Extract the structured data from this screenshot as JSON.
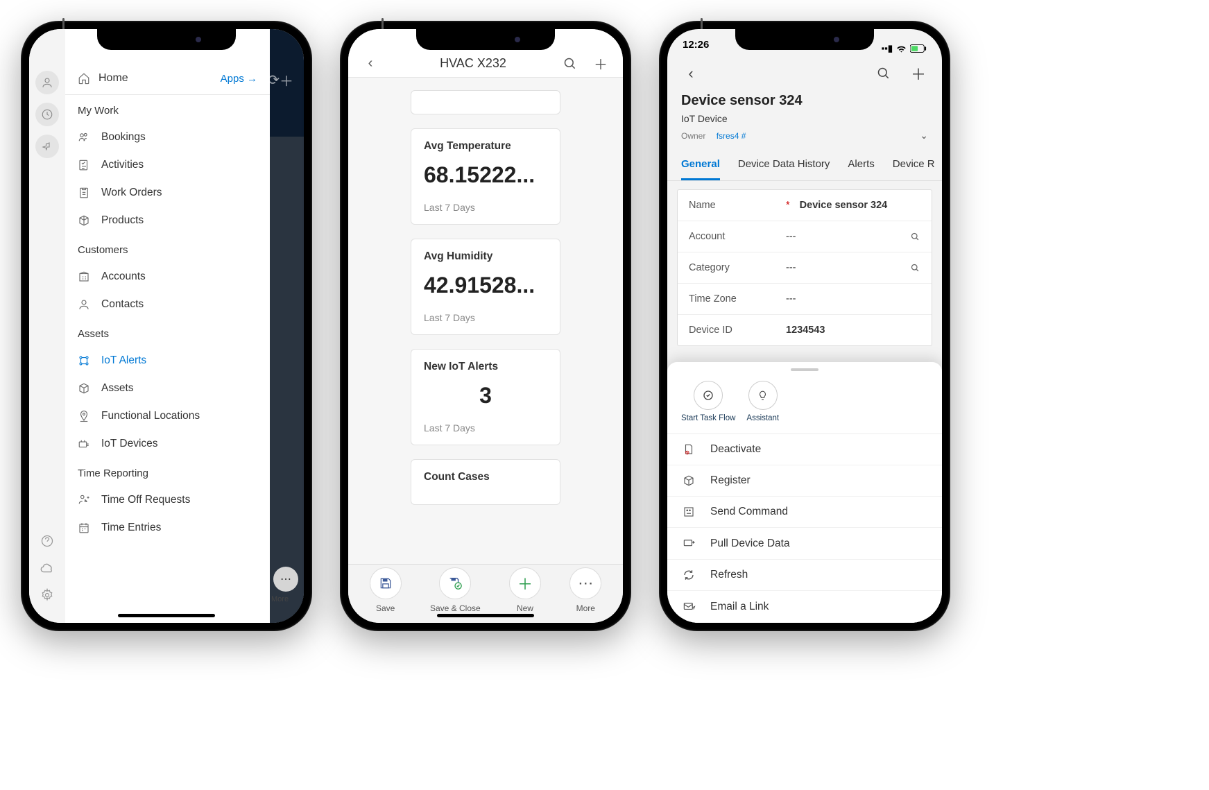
{
  "phone1": {
    "home": "Home",
    "apps": "Apps →",
    "sections": {
      "mywork": {
        "title": "My Work",
        "items": [
          {
            "icon": "bookings",
            "label": "Bookings"
          },
          {
            "icon": "activities",
            "label": "Activities"
          },
          {
            "icon": "workorders",
            "label": "Work Orders"
          },
          {
            "icon": "products",
            "label": "Products"
          }
        ]
      },
      "customers": {
        "title": "Customers",
        "items": [
          {
            "icon": "accounts",
            "label": "Accounts"
          },
          {
            "icon": "contacts",
            "label": "Contacts"
          }
        ]
      },
      "assets": {
        "title": "Assets",
        "items": [
          {
            "icon": "iotalerts",
            "label": "IoT Alerts",
            "active": true
          },
          {
            "icon": "assets",
            "label": "Assets"
          },
          {
            "icon": "locations",
            "label": "Functional Locations"
          },
          {
            "icon": "iotdevices",
            "label": "IoT Devices"
          }
        ]
      },
      "time": {
        "title": "Time Reporting",
        "items": [
          {
            "icon": "timeoff",
            "label": "Time Off Requests"
          },
          {
            "icon": "timeentries",
            "label": "Time Entries"
          }
        ]
      }
    },
    "more": "More"
  },
  "phone2": {
    "title": "HVAC X232",
    "cards": [
      {
        "title": "Avg Temperature",
        "value": "68.15222...",
        "sub": "Last 7 Days"
      },
      {
        "title": "Avg Humidity",
        "value": "42.91528...",
        "sub": "Last 7 Days"
      },
      {
        "title": "New IoT Alerts",
        "value": "3",
        "sub": "Last 7 Days",
        "center": true
      },
      {
        "title": "Count Cases",
        "value": "",
        "sub": ""
      }
    ],
    "bottom": [
      {
        "icon": "💾",
        "label": "Save",
        "color": "#3b5998"
      },
      {
        "icon": "save-close",
        "label": "Save & Close"
      },
      {
        "icon": "＋",
        "label": "New",
        "color": "#2e9e4f"
      },
      {
        "icon": "⋯",
        "label": "More",
        "color": "#555"
      }
    ]
  },
  "phone3": {
    "status": {
      "time": "12:26"
    },
    "title": "Device sensor 324",
    "subtitle": "IoT Device",
    "owner_label": "Owner",
    "owner_value": "fsres4 #",
    "tabs": [
      "General",
      "Device Data History",
      "Alerts",
      "Device R"
    ],
    "active_tab": 0,
    "fields": [
      {
        "label": "Name",
        "required": true,
        "value": "Device sensor 324",
        "bold": true
      },
      {
        "label": "Account",
        "value": "---",
        "lookup": true
      },
      {
        "label": "Category",
        "value": "---",
        "lookup": true
      },
      {
        "label": "Time Zone",
        "value": "---"
      },
      {
        "label": "Device ID",
        "value": "1234543",
        "bold": true
      }
    ],
    "quick_actions": [
      {
        "icon": "flow",
        "label": "Start Task Flow"
      },
      {
        "icon": "bulb",
        "label": "Assistant"
      }
    ],
    "actions": [
      {
        "icon": "deactivate",
        "label": "Deactivate"
      },
      {
        "icon": "register",
        "label": "Register"
      },
      {
        "icon": "command",
        "label": "Send Command"
      },
      {
        "icon": "pull",
        "label": "Pull Device Data"
      },
      {
        "icon": "refresh",
        "label": "Refresh"
      },
      {
        "icon": "email",
        "label": "Email a Link"
      }
    ]
  }
}
